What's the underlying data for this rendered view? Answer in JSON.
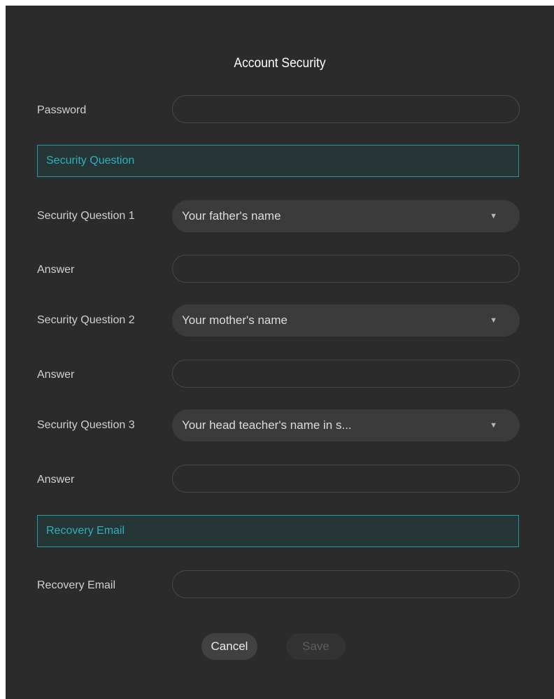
{
  "dialog": {
    "title": "Account Security"
  },
  "password": {
    "label": "Password",
    "value": ""
  },
  "security_section": {
    "title": "Security Question"
  },
  "questions": [
    {
      "label": "Security Question 1",
      "selected": "Your father's name",
      "answer_label": "Answer",
      "answer": ""
    },
    {
      "label": "Security Question 2",
      "selected": "Your mother's name",
      "answer_label": "Answer",
      "answer": ""
    },
    {
      "label": "Security Question 3",
      "selected": "Your head teacher's name in s...",
      "answer_label": "Answer",
      "answer": ""
    }
  ],
  "dropdown_arrow": "▼",
  "recovery_section": {
    "title": "Recovery Email"
  },
  "recovery_email": {
    "label": "Recovery Email",
    "value": ""
  },
  "buttons": {
    "cancel": "Cancel",
    "save": "Save"
  },
  "colors": {
    "background": "#2b2b2b",
    "accent": "#1f9aa6",
    "section_text": "#2fb0bd",
    "select_bg": "#3b3b3b"
  }
}
